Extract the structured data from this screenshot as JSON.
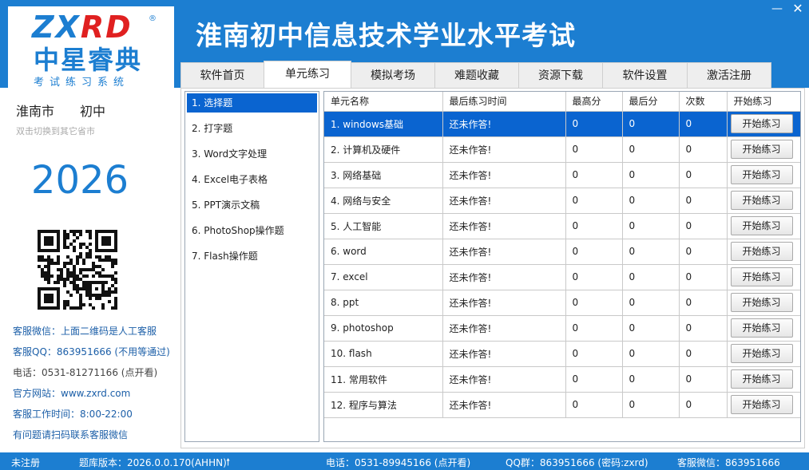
{
  "header": {
    "logo_mark_a": "ZX",
    "logo_mark_b": "RD",
    "logo_reg": "®",
    "logo_cn": "中星睿典",
    "logo_sub": "考试练习系统",
    "title": "淮南初中信息技术学业水平考试",
    "min_glyph": "—",
    "close_glyph": "✕"
  },
  "tabs": [
    "软件首页",
    "单元练习",
    "模拟考场",
    "难题收藏",
    "资源下载",
    "软件设置",
    "激活注册"
  ],
  "active_tab": "单元练习",
  "sidebar": {
    "city": "淮南市",
    "level": "初中",
    "switch_hint": "双击切换到其它省市",
    "year": "2026",
    "wechat": "客服微信：上面二维码是人工客服",
    "qq": "客服QQ：863951666 (不用等通过)",
    "phone": "电话：0531-81271166 (点开看)",
    "website": "官方网站：www.zxrd.com",
    "hours": "客服工作时间：8:00-22:00",
    "tip": "有问题请扫码联系客服微信"
  },
  "units": [
    "1. 选择题",
    "2. 打字题",
    "3. Word文字处理",
    "4. Excel电子表格",
    "5. PPT演示文稿",
    "6. PhotoShop操作题",
    "7. Flash操作题"
  ],
  "grid": {
    "columns": [
      "单元名称",
      "最后练习时间",
      "最高分",
      "最后分",
      "次数",
      "开始练习"
    ],
    "button_label": "开始练习",
    "rows": [
      [
        "1. windows基础",
        "还未作答!",
        "0",
        "0",
        "0"
      ],
      [
        "2. 计算机及硬件",
        "还未作答!",
        "0",
        "0",
        "0"
      ],
      [
        "3. 网络基础",
        "还未作答!",
        "0",
        "0",
        "0"
      ],
      [
        "4. 网络与安全",
        "还未作答!",
        "0",
        "0",
        "0"
      ],
      [
        "5. 人工智能",
        "还未作答!",
        "0",
        "0",
        "0"
      ],
      [
        "6. word",
        "还未作答!",
        "0",
        "0",
        "0"
      ],
      [
        "7. excel",
        "还未作答!",
        "0",
        "0",
        "0"
      ],
      [
        "8. ppt",
        "还未作答!",
        "0",
        "0",
        "0"
      ],
      [
        "9. photoshop",
        "还未作答!",
        "0",
        "0",
        "0"
      ],
      [
        "10. flash",
        "还未作答!",
        "0",
        "0",
        "0"
      ],
      [
        "11. 常用软件",
        "还未作答!",
        "0",
        "0",
        "0"
      ],
      [
        "12. 程序与算法",
        "还未作答!",
        "0",
        "0",
        "0"
      ]
    ]
  },
  "status": {
    "reg": "未注册",
    "version": "题库版本：2026.0.0.170(AHHN)",
    "upgrade_glyph": "🠕",
    "phone": "电话：0531-89945166 (点开看)",
    "qq_group": "QQ群：863951666 (密码:zxrd)",
    "wechat": "客服微信：863951666"
  },
  "colors": {
    "brand": "#1c7ed1",
    "selection": "#0a64d0",
    "logo_red": "#e02020"
  },
  "icons": {
    "minimize": "minimize-icon",
    "close": "close-icon",
    "upgrade": "arrow-up-icon",
    "qr": "qr-code-icon"
  }
}
